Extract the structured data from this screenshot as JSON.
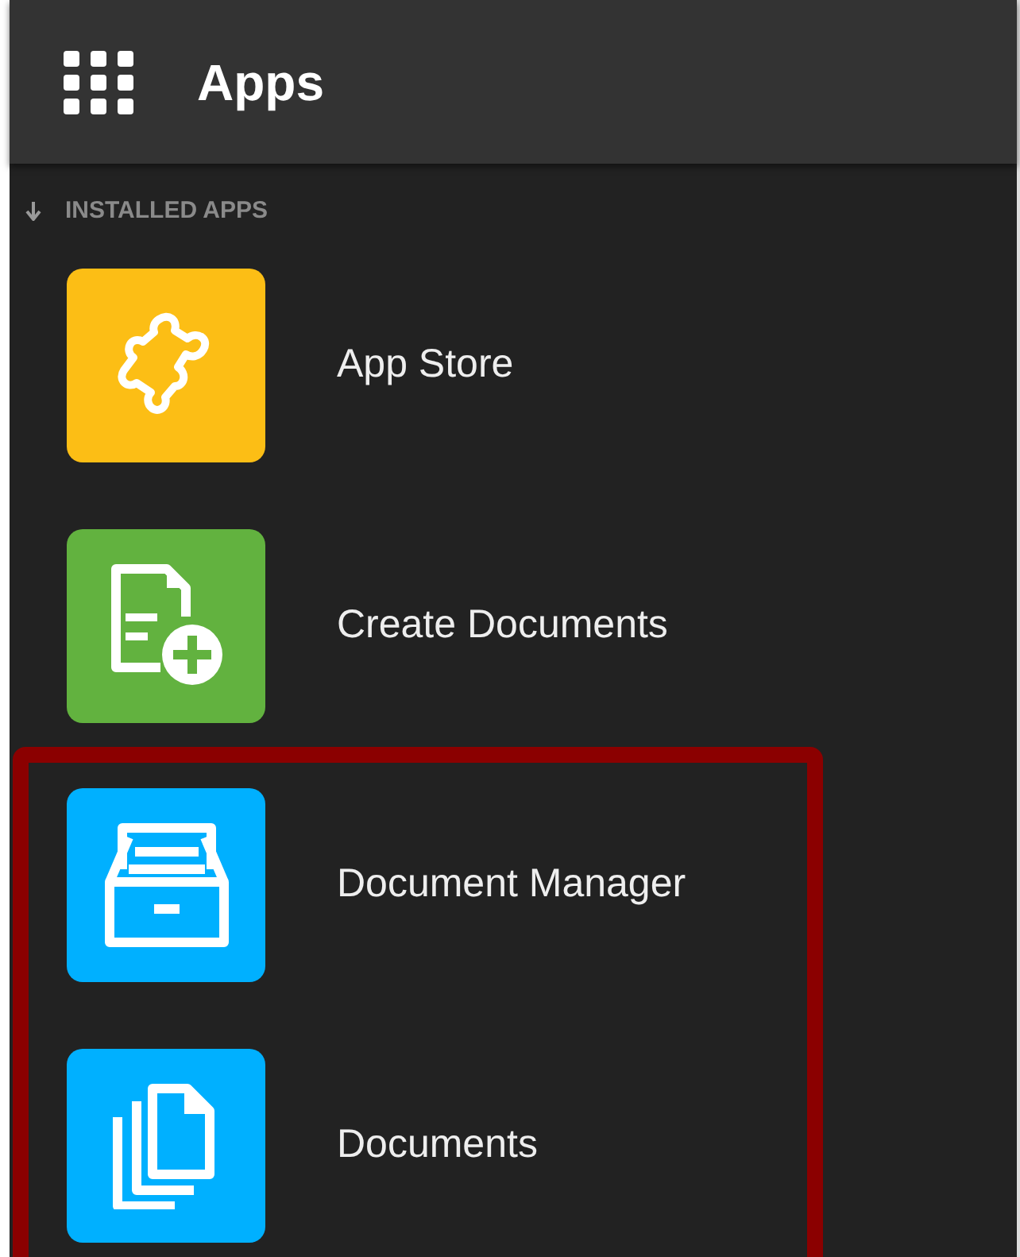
{
  "header": {
    "title": "Apps"
  },
  "section": {
    "label": "INSTALLED APPS",
    "expanded": true
  },
  "apps": [
    {
      "label": "App Store",
      "kind": "puzzle",
      "color": "#fcbe15",
      "highlighted": false
    },
    {
      "label": "Create Documents",
      "kind": "document-plus",
      "color": "#62b23f",
      "highlighted": false
    },
    {
      "label": "Document Manager",
      "kind": "file-cabinet",
      "color": "#00b0ff",
      "highlighted": true
    },
    {
      "label": "Documents",
      "kind": "documents",
      "color": "#00b0ff",
      "highlighted": true
    }
  ]
}
